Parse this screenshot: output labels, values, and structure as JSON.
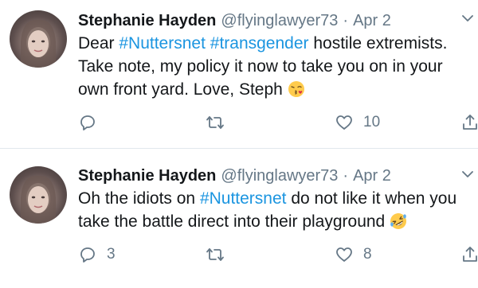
{
  "tweets": [
    {
      "name": "Stephanie Hayden",
      "handle": "@flyinglawyer73",
      "separator": "·",
      "date": "Apr 2",
      "body_lines": [
        [
          {
            "text": "Dear ",
            "hashtag": false
          },
          {
            "text": "#Nuttersnet",
            "hashtag": true
          },
          {
            "text": " ",
            "hashtag": false
          },
          {
            "text": "#transgender",
            "hashtag": true
          },
          {
            "text": " hostile extremists.",
            "hashtag": false
          }
        ],
        [
          {
            "text": "Take note, my policy it now to take you on in your",
            "hashtag": false
          }
        ],
        [
          {
            "text": "own front yard. Love, Steph",
            "hashtag": false
          }
        ]
      ],
      "emoji": "face-blowing-kiss-emoji",
      "reply_count": "",
      "retweet_count": "",
      "like_count": "10"
    },
    {
      "name": "Stephanie Hayden",
      "handle": "@flyinglawyer73",
      "separator": "·",
      "date": "Apr 2",
      "body_lines": [
        [
          {
            "text": "Oh the idiots on ",
            "hashtag": false
          },
          {
            "text": "#Nuttersnet",
            "hashtag": true
          },
          {
            "text": " do not like it when you",
            "hashtag": false
          }
        ],
        [
          {
            "text": "take the battle direct into their playground",
            "hashtag": false
          }
        ]
      ],
      "emoji": "rolling-on-floor-laughing-emoji",
      "reply_count": "3",
      "retweet_count": "",
      "like_count": "8"
    }
  ],
  "colors": {
    "text": "#14171a",
    "muted": "#657786",
    "hashtag": "#1b95e0",
    "divider": "#e1e8ed"
  },
  "icons": [
    "reply-icon",
    "retweet-icon",
    "like-icon",
    "share-icon",
    "caret-down-icon"
  ]
}
